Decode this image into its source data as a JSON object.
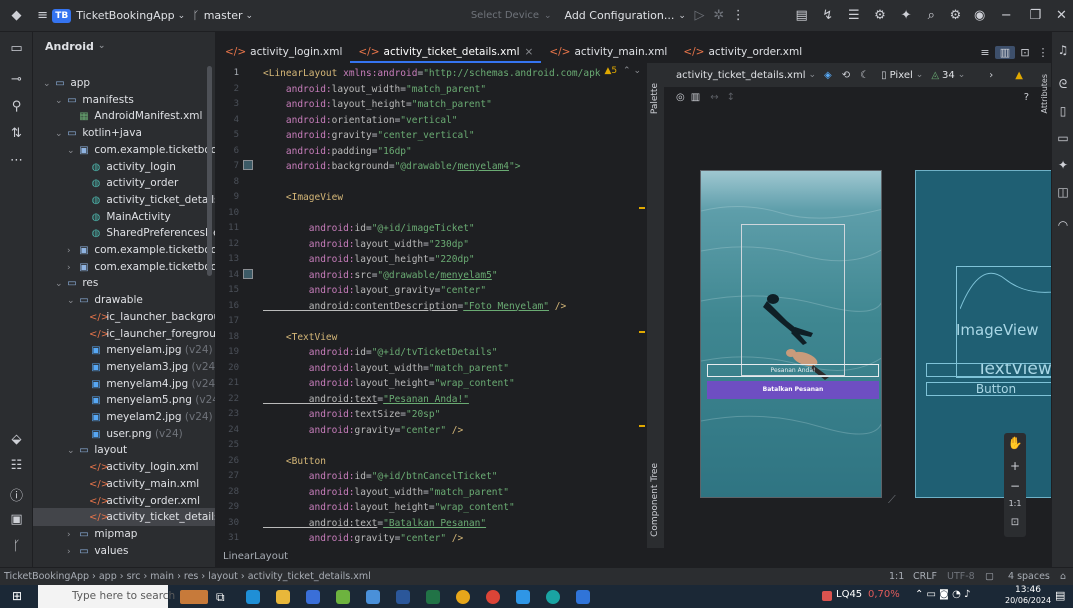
{
  "topbar": {
    "project_badge": "TB",
    "project_name": "TicketBookingApp",
    "branch": "master",
    "device": "Select Device",
    "config": "Add Configuration..."
  },
  "project_panel": {
    "title": "Android",
    "tree": [
      {
        "label": "app",
        "level": 0,
        "icon": "folder",
        "expanded": true
      },
      {
        "label": "manifests",
        "level": 1,
        "icon": "folder",
        "expanded": true
      },
      {
        "label": "AndroidManifest.xml",
        "level": 2,
        "icon": "manifest"
      },
      {
        "label": "kotlin+java",
        "level": 1,
        "icon": "folder",
        "expanded": true
      },
      {
        "label": "com.example.ticketbookin",
        "level": 2,
        "icon": "package",
        "expanded": true
      },
      {
        "label": "activity_login",
        "level": 3,
        "icon": "class"
      },
      {
        "label": "activity_order",
        "level": 3,
        "icon": "class"
      },
      {
        "label": "activity_ticket_details",
        "level": 3,
        "icon": "class"
      },
      {
        "label": "MainActivity",
        "level": 3,
        "icon": "class"
      },
      {
        "label": "SharedPreferencesHelp",
        "level": 3,
        "icon": "class"
      },
      {
        "label": "com.example.ticketbookin",
        "level": 2,
        "icon": "package",
        "expanded": false
      },
      {
        "label": "com.example.ticketbookin",
        "level": 2,
        "icon": "package",
        "expanded": false
      },
      {
        "label": "res",
        "level": 1,
        "icon": "folder",
        "expanded": true
      },
      {
        "label": "drawable",
        "level": 2,
        "icon": "folder",
        "expanded": true
      },
      {
        "label": "ic_launcher_backgroun",
        "level": 3,
        "icon": "xml"
      },
      {
        "label": "ic_launcher_foregroun",
        "level": 3,
        "icon": "xml"
      },
      {
        "label": "menyelam.jpg",
        "suffix": "(v24)",
        "level": 3,
        "icon": "image"
      },
      {
        "label": "menyelam3.jpg",
        "suffix": "(v24)",
        "level": 3,
        "icon": "image"
      },
      {
        "label": "menyelam4.jpg",
        "suffix": "(v24)",
        "level": 3,
        "icon": "image"
      },
      {
        "label": "menyelam5.png",
        "suffix": "(v24)",
        "level": 3,
        "icon": "image"
      },
      {
        "label": "meyelam2.jpg",
        "suffix": "(v24)",
        "level": 3,
        "icon": "image"
      },
      {
        "label": "user.png",
        "suffix": "(v24)",
        "level": 3,
        "icon": "image"
      },
      {
        "label": "layout",
        "level": 2,
        "icon": "folder",
        "expanded": true
      },
      {
        "label": "activity_login.xml",
        "level": 3,
        "icon": "xml"
      },
      {
        "label": "activity_main.xml",
        "level": 3,
        "icon": "xml"
      },
      {
        "label": "activity_order.xml",
        "level": 3,
        "icon": "xml"
      },
      {
        "label": "activity_ticket_details.x",
        "level": 3,
        "icon": "xml",
        "selected": true
      },
      {
        "label": "mipmap",
        "level": 2,
        "icon": "folder",
        "expanded": false
      },
      {
        "label": "values",
        "level": 2,
        "icon": "folder",
        "expanded": false
      }
    ]
  },
  "tabs": [
    {
      "label": "activity_login.xml",
      "active": false
    },
    {
      "label": "activity_ticket_details.xml",
      "active": true
    },
    {
      "label": "activity_main.xml",
      "active": false
    },
    {
      "label": "activity_order.xml",
      "active": false
    }
  ],
  "editor": {
    "warning_count": "5",
    "footer": "LinearLayout",
    "lines": [
      [
        {
          "t": "<",
          "c": "tag"
        },
        {
          "t": "LinearLayout ",
          "c": "tag"
        },
        {
          "t": "xmlns:",
          "c": "ns"
        },
        {
          "t": "android",
          "c": "ns"
        },
        {
          "t": "=",
          "c": "plain"
        },
        {
          "t": "\"http://schemas.android.com/apk",
          "c": "str"
        }
      ],
      [
        {
          "t": "    android:",
          "c": "ns"
        },
        {
          "t": "layout_width",
          "c": "attr"
        },
        {
          "t": "=",
          "c": "plain"
        },
        {
          "t": "\"match_parent\"",
          "c": "str"
        }
      ],
      [
        {
          "t": "    android:",
          "c": "ns"
        },
        {
          "t": "layout_height",
          "c": "attr"
        },
        {
          "t": "=",
          "c": "plain"
        },
        {
          "t": "\"match_parent\"",
          "c": "str"
        }
      ],
      [
        {
          "t": "    android:",
          "c": "ns"
        },
        {
          "t": "orientation",
          "c": "attr"
        },
        {
          "t": "=",
          "c": "plain"
        },
        {
          "t": "\"vertical\"",
          "c": "str"
        }
      ],
      [
        {
          "t": "    android:",
          "c": "ns"
        },
        {
          "t": "gravity",
          "c": "attr"
        },
        {
          "t": "=",
          "c": "plain"
        },
        {
          "t": "\"center_vertical\"",
          "c": "str"
        }
      ],
      [
        {
          "t": "    android:",
          "c": "ns"
        },
        {
          "t": "padding",
          "c": "attr"
        },
        {
          "t": "=",
          "c": "plain"
        },
        {
          "t": "\"16dp\"",
          "c": "str"
        }
      ],
      [
        {
          "t": "    android:",
          "c": "ns"
        },
        {
          "t": "background",
          "c": "attr"
        },
        {
          "t": "=",
          "c": "plain"
        },
        {
          "t": "\"@drawable/",
          "c": "str"
        },
        {
          "t": "menyelam4",
          "c": "str ul"
        },
        {
          "t": "\">",
          "c": "str"
        }
      ],
      [],
      [
        {
          "t": "    <ImageView",
          "c": "tag"
        }
      ],
      [],
      [
        {
          "t": "        android:",
          "c": "ns"
        },
        {
          "t": "id",
          "c": "attr"
        },
        {
          "t": "=",
          "c": "plain"
        },
        {
          "t": "\"@+id/imageTicket\"",
          "c": "str"
        }
      ],
      [
        {
          "t": "        android:",
          "c": "ns"
        },
        {
          "t": "layout_width",
          "c": "attr"
        },
        {
          "t": "=",
          "c": "plain"
        },
        {
          "t": "\"230dp\"",
          "c": "str"
        }
      ],
      [
        {
          "t": "        android:",
          "c": "ns"
        },
        {
          "t": "layout_height",
          "c": "attr"
        },
        {
          "t": "=",
          "c": "plain"
        },
        {
          "t": "\"220dp\"",
          "c": "str"
        }
      ],
      [
        {
          "t": "        android:",
          "c": "ns"
        },
        {
          "t": "src",
          "c": "attr"
        },
        {
          "t": "=",
          "c": "plain"
        },
        {
          "t": "\"@drawable/",
          "c": "str"
        },
        {
          "t": "menyelam5",
          "c": "str ul"
        },
        {
          "t": "\"",
          "c": "str"
        }
      ],
      [
        {
          "t": "        android:",
          "c": "ns"
        },
        {
          "t": "layout_gravity",
          "c": "attr"
        },
        {
          "t": "=",
          "c": "plain"
        },
        {
          "t": "\"center\"",
          "c": "str"
        }
      ],
      [
        {
          "t": "        android:contentDescription",
          "c": "attr ul"
        },
        {
          "t": "=",
          "c": "plain"
        },
        {
          "t": "\"Foto Menyelam\"",
          "c": "str ul"
        },
        {
          "t": " />",
          "c": "tag"
        }
      ],
      [],
      [
        {
          "t": "    <TextView",
          "c": "tag"
        }
      ],
      [
        {
          "t": "        android:",
          "c": "ns"
        },
        {
          "t": "id",
          "c": "attr"
        },
        {
          "t": "=",
          "c": "plain"
        },
        {
          "t": "\"@+id/tvTicketDetails\"",
          "c": "str"
        }
      ],
      [
        {
          "t": "        android:",
          "c": "ns"
        },
        {
          "t": "layout_width",
          "c": "attr"
        },
        {
          "t": "=",
          "c": "plain"
        },
        {
          "t": "\"match_parent\"",
          "c": "str"
        }
      ],
      [
        {
          "t": "        android:",
          "c": "ns"
        },
        {
          "t": "layout_height",
          "c": "attr"
        },
        {
          "t": "=",
          "c": "plain"
        },
        {
          "t": "\"wrap_content\"",
          "c": "str"
        }
      ],
      [
        {
          "t": "        android:text",
          "c": "attr ul"
        },
        {
          "t": "=",
          "c": "plain"
        },
        {
          "t": "\"Pesanan Anda!\"",
          "c": "str ul"
        }
      ],
      [
        {
          "t": "        android:",
          "c": "ns"
        },
        {
          "t": "textSize",
          "c": "attr"
        },
        {
          "t": "=",
          "c": "plain"
        },
        {
          "t": "\"20sp\"",
          "c": "str"
        }
      ],
      [
        {
          "t": "        android:",
          "c": "ns"
        },
        {
          "t": "gravity",
          "c": "attr"
        },
        {
          "t": "=",
          "c": "plain"
        },
        {
          "t": "\"center\"",
          "c": "str"
        },
        {
          "t": " />",
          "c": "tag"
        }
      ],
      [],
      [
        {
          "t": "    <Button",
          "c": "tag"
        }
      ],
      [
        {
          "t": "        android:",
          "c": "ns"
        },
        {
          "t": "id",
          "c": "attr"
        },
        {
          "t": "=",
          "c": "plain"
        },
        {
          "t": "\"@+id/btnCancelTicket\"",
          "c": "str"
        }
      ],
      [
        {
          "t": "        android:",
          "c": "ns"
        },
        {
          "t": "layout_width",
          "c": "attr"
        },
        {
          "t": "=",
          "c": "plain"
        },
        {
          "t": "\"match_parent\"",
          "c": "str"
        }
      ],
      [
        {
          "t": "        android:",
          "c": "ns"
        },
        {
          "t": "layout_height",
          "c": "attr"
        },
        {
          "t": "=",
          "c": "plain"
        },
        {
          "t": "\"wrap_content\"",
          "c": "str"
        }
      ],
      [
        {
          "t": "        android:text",
          "c": "attr ul"
        },
        {
          "t": "=",
          "c": "plain"
        },
        {
          "t": "\"Batalkan Pesanan\"",
          "c": "str ul"
        }
      ],
      [
        {
          "t": "        android:",
          "c": "ns"
        },
        {
          "t": "gravity",
          "c": "attr"
        },
        {
          "t": "=",
          "c": "plain"
        },
        {
          "t": "\"center\"",
          "c": "str"
        },
        {
          "t": " />",
          "c": "tag"
        }
      ]
    ]
  },
  "side_labels": {
    "palette": "Palette",
    "component_tree": "Component Tree",
    "attributes": "Attributes"
  },
  "design": {
    "file": "activity_ticket_details.xml",
    "device": "Pixel",
    "api": "34",
    "preview_text": "Pesanan Anda!",
    "preview_button": "Batalkan Pesanan",
    "blueprint_image": "ImageView",
    "blueprint_text": "TextView",
    "blueprint_button": "Button",
    "zoom_ratio": "1:1"
  },
  "statusbar": {
    "crumbs": [
      "TicketBookingApp",
      "app",
      "src",
      "main",
      "res",
      "layout",
      "activity_ticket_details.xml"
    ],
    "position": "1:1",
    "line_sep": "CRLF",
    "encoding": "UTF-8",
    "indent": "4 spaces"
  },
  "taskbar": {
    "search_placeholder": "Type here to search",
    "aqi": "LQ45",
    "aqi_change": "0,70%",
    "time": "13:46",
    "date": "20/06/2024"
  }
}
